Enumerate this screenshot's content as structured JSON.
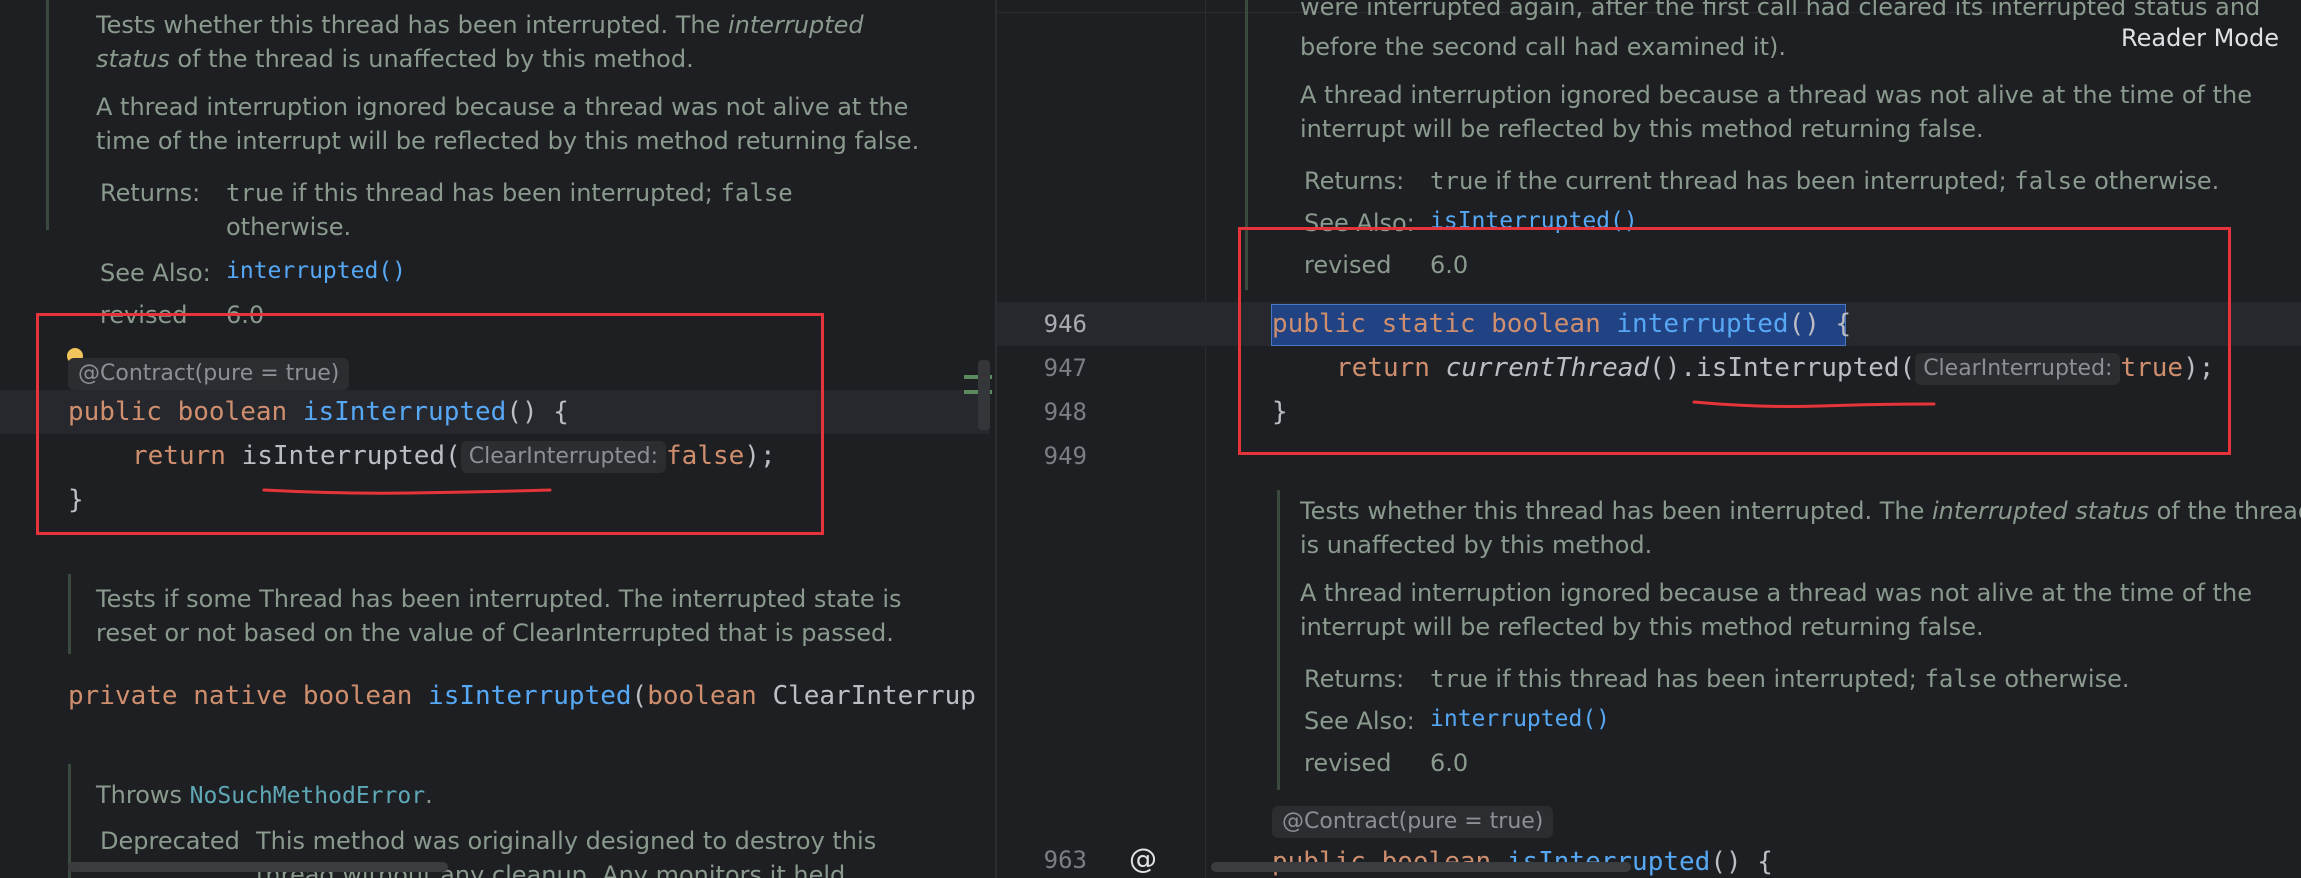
{
  "left": {
    "doc1": {
      "line1_a": "Tests whether this thread has been interrupted. The ",
      "line1_em": "interrupted",
      "line2_em": "status",
      "line2_b": " of the thread is unaffected by this method.",
      "para2_line1": "A thread interruption ignored because a thread was not alive at the",
      "para2_line2": "time of the interrupt will be reflected by this method returning false.",
      "returns_label": "Returns:",
      "returns_true": "true",
      "returns_mid": " if this thread has been interrupted; ",
      "returns_false": "false",
      "returns_line2": "otherwise.",
      "see_also_label": "See Also:",
      "see_also_link": "interrupted()",
      "revised_label": "revised",
      "revised_value": "6.0"
    },
    "annotation": "@Contract(pure = true)",
    "code": {
      "l1_kw1": "public",
      "l1_kw2": "boolean",
      "l1_fn": "isInterrupted",
      "l1_rest": "() {",
      "l2_kw": "return",
      "l2_call": "isInterrupted(",
      "l2_hint": "ClearInterrupted:",
      "l2_val": "false",
      "l2_end": ");",
      "l3": "}"
    },
    "doc2": {
      "line1": "Tests if some Thread has been interrupted. The interrupted state is",
      "line2": "reset or not based on the value of ClearInterrupted that is passed."
    },
    "native_line": {
      "kw1": "private",
      "kw2": "native",
      "kw3": "boolean",
      "fn": "isInterrupted",
      "open": "(",
      "kw4": "boolean",
      "param": "ClearInterrup"
    },
    "doc3": {
      "throws_text": "Throws ",
      "throws_link": "NoSuchMethodError",
      "throws_end": ".",
      "deprecated_label": "Deprecated",
      "deprecated_line1": "This method was originally designed to destroy this",
      "deprecated_line2": "thread without any cleanup. Any monitors it held"
    }
  },
  "right": {
    "reader_mode": "Reader Mode",
    "doc_top": {
      "line1": "were interrupted again, after the first call had cleared its interrupted status and",
      "line2": "before the second call had examined it).",
      "para2_line1": "A thread interruption ignored because a thread was not alive at the time of the",
      "para2_line2": "interrupt will be reflected by this method returning false.",
      "returns_label": "Returns:",
      "returns_true": "true",
      "returns_mid": " if the current thread has been interrupted; ",
      "returns_false": "false",
      "returns_end": " otherwise.",
      "see_also_label": "See Also:",
      "see_also_link": "isInterrupted()",
      "revised_label": "revised",
      "revised_value": "6.0"
    },
    "line_numbers": {
      "n946": "946",
      "n947": "947",
      "n948": "948",
      "n949": "949",
      "n963": "963"
    },
    "code": {
      "l1_kw1": "public",
      "l1_kw2": "static",
      "l1_kw3": "boolean",
      "l1_fn": "interrupted",
      "l1_paren": "()",
      "l1_brace": " {",
      "l2_kw": "return",
      "l2_call1": "currentThread",
      "l2_mid": "().isInterrupted(",
      "l2_hint": "ClearInterrupted:",
      "l2_val": "true",
      "l2_end": ");",
      "l3": "}"
    },
    "doc_bottom": {
      "line1_a": "Tests whether this thread has been interrupted. The ",
      "line1_em": "interrupted status",
      "line1_b": " of the thread",
      "line2": "is unaffected by this method.",
      "para2_line1": "A thread interruption ignored because a thread was not alive at the time of the",
      "para2_line2": "interrupt will be reflected by this method returning false.",
      "returns_label": "Returns:",
      "returns_true": "true",
      "returns_mid": " if this thread has been interrupted; ",
      "returns_false": "false",
      "returns_end": " otherwise.",
      "see_also_label": "See Also:",
      "see_also_link": "interrupted()",
      "revised_label": "revised",
      "revised_value": "6.0"
    },
    "annotation": "@Contract(pure = true)",
    "last_line": {
      "kw1": "public",
      "kw2": "boolean",
      "fn": "isInterrupted",
      "rest": "() {"
    }
  },
  "colors": {
    "background": "#1e1f22",
    "keyword": "#cf8e6d",
    "function": "#56a8f5",
    "doc_text": "#8a9a8e",
    "highlight_box": "#e5353a",
    "selection": "#214283"
  }
}
